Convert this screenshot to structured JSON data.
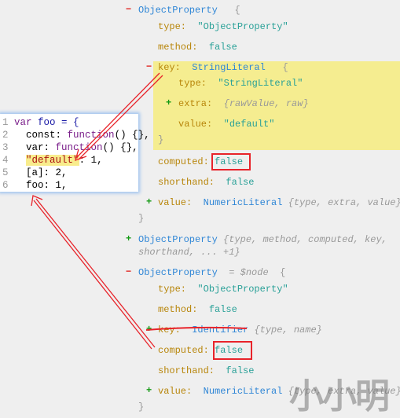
{
  "tree": {
    "n1": {
      "label": "ObjectProperty",
      "brace": "{"
    },
    "n1_type": {
      "key": "type:",
      "value": "\"ObjectProperty\""
    },
    "n1_method": {
      "key": "method:",
      "value": "false"
    },
    "n1_key": {
      "key": "key:",
      "value": "StringLiteral",
      "brace": "{"
    },
    "n1_key_type": {
      "key": "type:",
      "value": "\"StringLiteral\""
    },
    "n1_key_extra": {
      "key": "extra:",
      "summary": "{rawValue, raw}"
    },
    "n1_key_value": {
      "key": "value:",
      "value": "\"default\""
    },
    "close": "}",
    "n1_computed": {
      "key": "computed:",
      "value": "false"
    },
    "n1_shorthand": {
      "key": "shorthand:",
      "value": "false"
    },
    "n1_value": {
      "key": "value:",
      "value": "NumericLiteral",
      "summary": "{type, extra, value}"
    },
    "n2": {
      "label": "ObjectProperty",
      "summary1": "{type, method, computed, key,",
      "summary2": "shorthand, ... +1}"
    },
    "n3": {
      "label": "ObjectProperty",
      "ref": "= $node",
      "brace": "{"
    },
    "n3_type": {
      "key": "type:",
      "value": "\"ObjectProperty\""
    },
    "n3_method": {
      "key": "method:",
      "value": "false"
    },
    "n3_key": {
      "key": "key:",
      "value": "Identifier",
      "summary": "{type, name}"
    },
    "n3_computed": {
      "key": "computed:",
      "value": "false"
    },
    "n3_shorthand": {
      "key": "shorthand:",
      "value": "false"
    },
    "n3_value": {
      "key": "value:",
      "value": "NumericLiteral",
      "summary": "{type, extra, value}"
    },
    "collapse": "−",
    "expand": "+"
  },
  "code": {
    "lines": [
      {
        "n": "1",
        "a": "var",
        "b": " foo = {"
      },
      {
        "n": "2",
        "a": "  const: ",
        "b": "function",
        "c": "() {},"
      },
      {
        "n": "3",
        "a": "  var: ",
        "b": "function",
        "c": "() {},"
      },
      {
        "n": "4",
        "a": "  ",
        "s": "\"default\"",
        "c": ": 1,"
      },
      {
        "n": "5",
        "a": "  [a]: 2,"
      },
      {
        "n": "6",
        "a": "  foo: 1,"
      }
    ]
  },
  "watermark": "小小明",
  "colors": {
    "annotation": "#e8232a",
    "highlight": "#f5ed90"
  }
}
